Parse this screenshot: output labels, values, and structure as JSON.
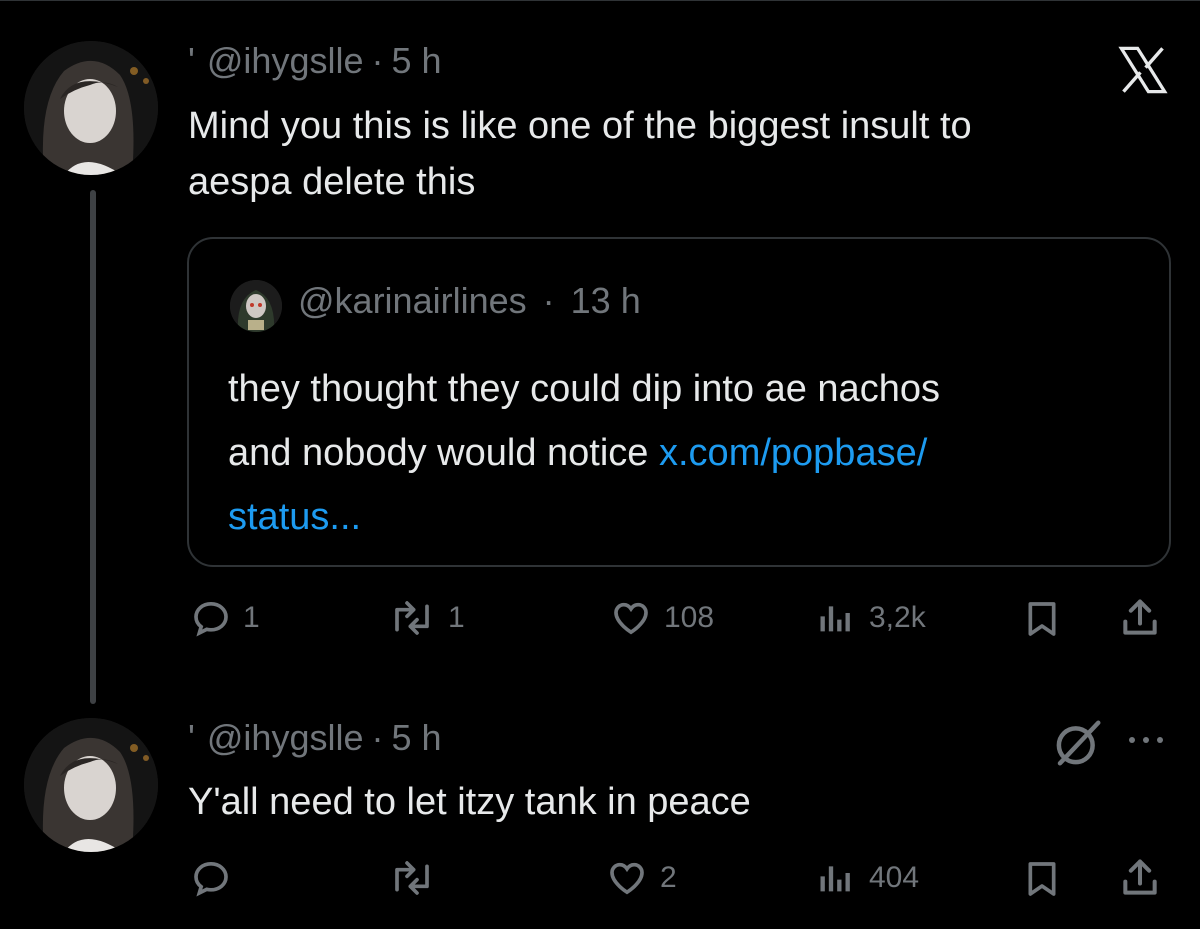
{
  "tweet1": {
    "handle": "@ihygslle",
    "prefix": "'",
    "time": "5 h",
    "text_line1": "Mind you this is like one of the biggest insult to",
    "text_line2": "aespa delete this",
    "quote": {
      "handle": "@karinairlines",
      "time": "13 h",
      "text_line1": "they thought they could dip into ae nachos",
      "text_line2": "and nobody would notice ",
      "link_part1": "x.com/popbase/",
      "link_part2": "status..."
    },
    "actions": {
      "replies": "1",
      "reposts": "1",
      "likes": "108",
      "views": "3,2k"
    }
  },
  "tweet2": {
    "handle": "@ihygslle",
    "prefix": "'",
    "time": "5 h",
    "text": "Y'all need to let itzy tank in peace",
    "actions": {
      "likes": "2",
      "views": "404"
    }
  },
  "separator": "·",
  "colors": {
    "background": "#000000",
    "text": "#e7e9ea",
    "muted": "#71767b",
    "link": "#1d9bf0",
    "border": "#2f3336"
  }
}
